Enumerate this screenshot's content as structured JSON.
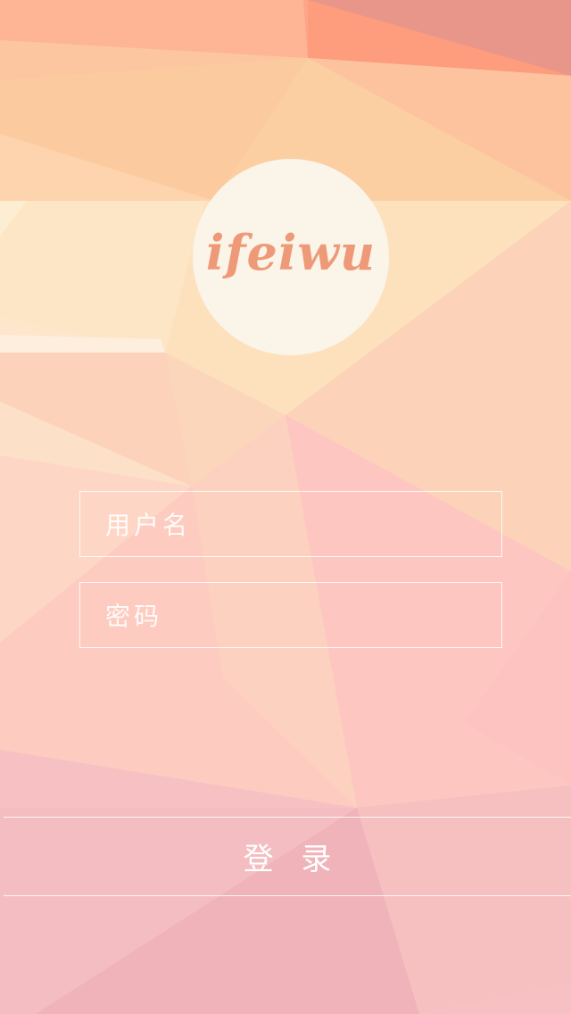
{
  "app": {
    "logo_text": "ifeiwu"
  },
  "login_form": {
    "username_placeholder": "用户名",
    "password_placeholder": "密码",
    "login_label": "登 录"
  },
  "colors": {
    "logo_text": "#ee9a78",
    "logo_circle": "#fbf4e8",
    "border": "#ffffff"
  }
}
